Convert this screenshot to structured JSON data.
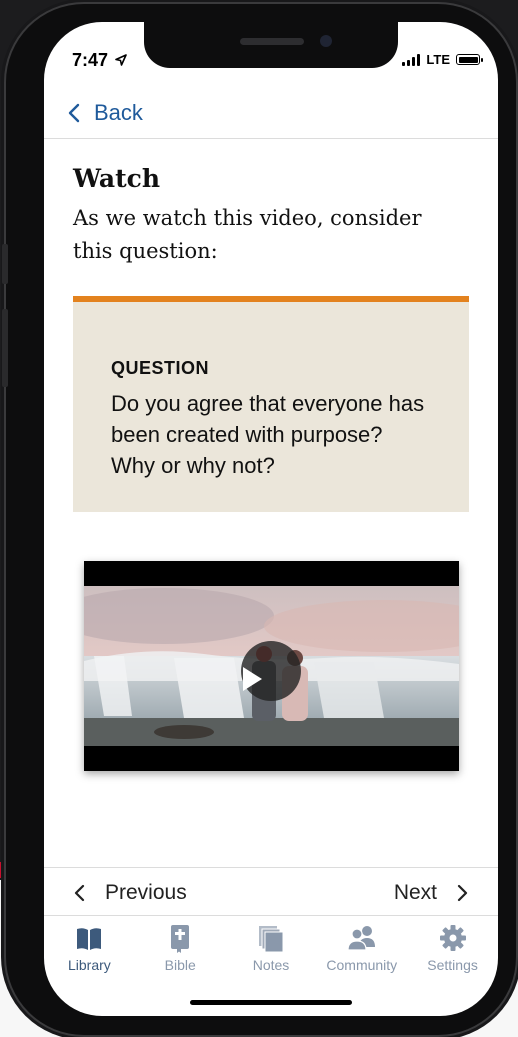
{
  "status_bar": {
    "time": "7:47",
    "network": "LTE"
  },
  "header": {
    "back_label": "Back"
  },
  "content": {
    "title": "Watch",
    "subtitle": "As we watch this video, consider this question:",
    "question_label": "QUESTION",
    "question_text": "Do you agree that everyone has been created with purpose? Why or why not?"
  },
  "pager": {
    "previous_label": "Previous",
    "next_label": "Next"
  },
  "tabs": [
    {
      "label": "Library",
      "icon": "book-icon"
    },
    {
      "label": "Bible",
      "icon": "bible-icon"
    },
    {
      "label": "Notes",
      "icon": "notes-icon"
    },
    {
      "label": "Community",
      "icon": "community-icon"
    },
    {
      "label": "Settings",
      "icon": "gear-icon"
    }
  ],
  "colors": {
    "accent_blue": "#1f5a9b",
    "question_bg": "#ebe6da",
    "question_border": "#e3821e",
    "tab_active": "#3d5a7c",
    "tab_inactive": "#8a98ab"
  }
}
